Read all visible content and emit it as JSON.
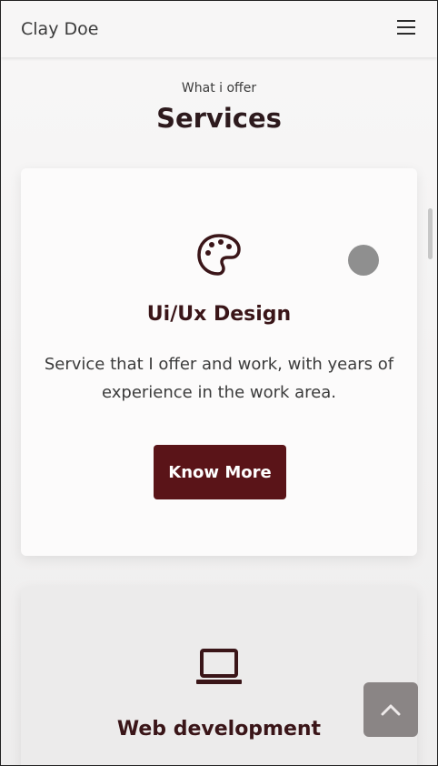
{
  "header": {
    "brand": "Clay Doe",
    "menu_icon": "hamburger-menu-icon"
  },
  "section": {
    "subtitle": "What i offer",
    "title": "Services"
  },
  "services": [
    {
      "icon": "palette-icon",
      "title": "Ui/Ux Design",
      "description": "Service that I offer and work, with years of experience in the work area.",
      "button_label": "Know More"
    },
    {
      "icon": "laptop-icon",
      "title": "Web development"
    }
  ],
  "scroll_to_top_icon": "chevron-up-icon",
  "colors": {
    "accent": "#5a1418",
    "text_dark": "#3a1518",
    "background": "#f3f1f1"
  }
}
